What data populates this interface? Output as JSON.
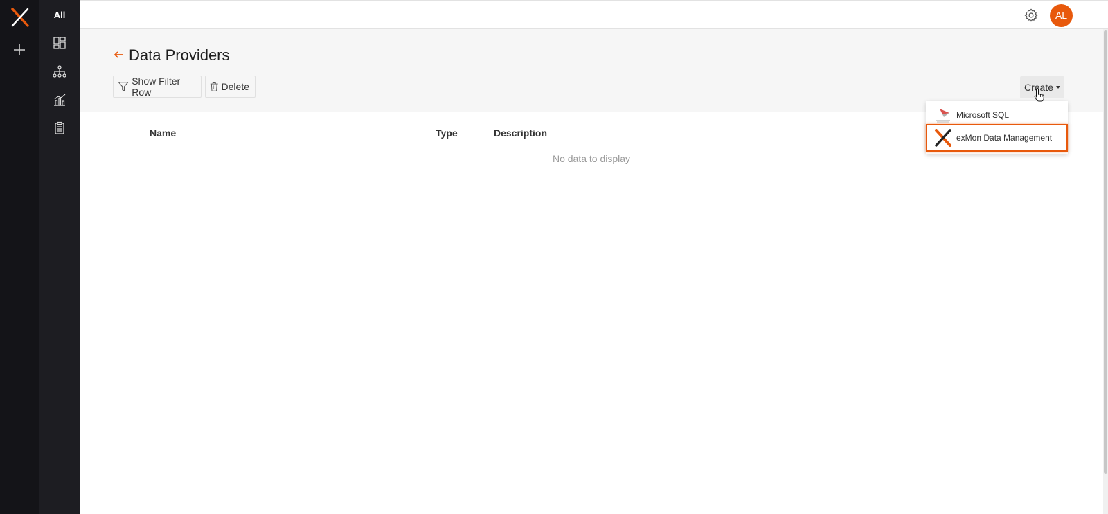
{
  "sidebar": {
    "all_label": "All",
    "icons": [
      "dashboard-icon",
      "hierarchy-icon",
      "chart-icon",
      "clipboard-icon"
    ]
  },
  "topbar": {
    "avatar_initials": "AL"
  },
  "page": {
    "title": "Data Providers"
  },
  "toolbar": {
    "filter_label": "Show Filter Row",
    "delete_label": "Delete",
    "create_label": "Create"
  },
  "table": {
    "columns": [
      "Name",
      "Type",
      "Description"
    ],
    "empty_text": "No data to display"
  },
  "create_menu": {
    "items": [
      "Microsoft SQL",
      "exMon Data Management"
    ],
    "highlighted": "exMon Data Management"
  },
  "colors": {
    "accent": "#e8590c",
    "rail": "#141418",
    "sidebar": "#1d1d22"
  }
}
